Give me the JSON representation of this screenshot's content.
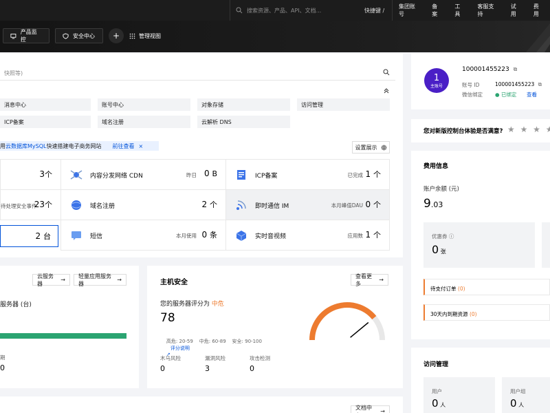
{
  "topbar": {
    "search_placeholder": "搜索资源、产品、API、文档...",
    "shortcut": "快捷键 /",
    "nav": [
      "集团账号",
      "备案",
      "工具",
      "客服支持",
      "试用",
      "费用"
    ]
  },
  "subbar": {
    "product_monitor": "产品监控",
    "security_center": "安全中心",
    "plus": "+",
    "manage_view": "管理视图"
  },
  "main": {
    "search_hint": "快照等)",
    "products": [
      [
        "消息中心",
        "账号中心",
        "对象存储",
        "访问管理"
      ],
      [
        "ICP备案",
        "域名注册",
        "云解析 DNS"
      ]
    ],
    "notice": {
      "prefix": "用 ",
      "link": "云数据库MySQL",
      "suffix": " 快速搭建电子商务网站",
      "action": "前往查看",
      "close": "×"
    },
    "settings_label": "设置展示",
    "grid": [
      [
        {
          "name": "",
          "meta": "",
          "value": "3",
          "unit": "个"
        },
        {
          "name": "内容分发网络 CDN",
          "meta": "昨日",
          "value": "0",
          "unit": "B"
        },
        {
          "name": "ICP备案",
          "meta": "已完成",
          "value": "1",
          "unit": "个"
        }
      ],
      [
        {
          "name": "",
          "meta": "待处理安全事件",
          "value": "23",
          "unit": "个"
        },
        {
          "name": "域名注册",
          "meta": "",
          "value": "2",
          "unit": "个"
        },
        {
          "name": "即时通信 IM",
          "meta": "本月峰值DAU",
          "value": "0",
          "unit": "个"
        }
      ],
      [
        {
          "name": "",
          "meta": "",
          "value": "2",
          "unit": "台"
        },
        {
          "name": "短信",
          "meta": "本月使用",
          "value": "0",
          "unit": "条"
        },
        {
          "name": "实时音视频",
          "meta": "应用数",
          "value": "1",
          "unit": "个"
        }
      ]
    ]
  },
  "servers": {
    "btn_cvm": "云服务器",
    "btn_lighthouse": "轻量应用服务器",
    "label": "服务器 (台)",
    "expire_label": "期",
    "expire_value": "0"
  },
  "host_security": {
    "title": "主机安全",
    "more": "查看更多",
    "score_label": "您的服务器评分为",
    "level": "中危",
    "score": "78",
    "legend": "高危: 20-59    中危: 60-89    安全: 90-100",
    "legend_link": "评分说明",
    "stats": [
      {
        "label": "木马风险",
        "value": "0"
      },
      {
        "label": "漏洞风险",
        "value": "3"
      },
      {
        "label": "攻击检测",
        "value": "0"
      }
    ],
    "gauge_fraction": 0.78
  },
  "docs_btn": "文档中心",
  "account": {
    "avatar_num": "1",
    "avatar_role": "主账号",
    "uin": "100001455223",
    "id_label": "账号 ID",
    "id_value": "100001455223",
    "wechat_label": "微信绑定",
    "wechat_status": "已绑定",
    "view": "查看"
  },
  "survey": {
    "question": "您对新版控制台体验是否满意?",
    "stars": "★ ★ ★ ★"
  },
  "fee": {
    "title": "费用信息",
    "balance_label": "账户余额 (元)",
    "balance_int": "9",
    "balance_dec": ".03",
    "coupon_label": "优惠券",
    "coupon_value": "0",
    "coupon_unit": "张",
    "pending_label": "待支付订单",
    "pending_value": "(0)",
    "expiring_label": "30天内到期资源",
    "expiring_value": "(0)"
  },
  "visit": {
    "title": "访问管理",
    "users_label": "用户",
    "users_value": "0",
    "users_unit": "人",
    "groups_label": "用户组",
    "groups_value": "0",
    "groups_unit": "人"
  },
  "colors": {
    "accent": "#0052d9",
    "warning": "#ed7b2f",
    "success": "#2ba471",
    "avatar": "#4a1fc6"
  }
}
